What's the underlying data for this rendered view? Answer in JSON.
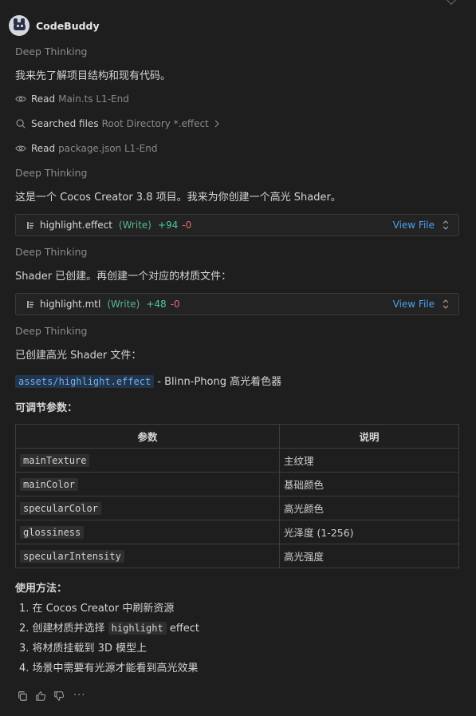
{
  "header": {
    "brand": "CodeBuddy"
  },
  "blocks": {
    "deep1": "Deep Thinking",
    "msg1": "我来先了解项目结构和现有代码。",
    "tool1": {
      "verb": "Read",
      "detail": "Main.ts L1-End"
    },
    "tool2": {
      "verb": "Searched files",
      "detail": "Root Directory *.effect"
    },
    "tool3": {
      "verb": "Read",
      "detail": "package.json L1-End"
    },
    "deep2": "Deep Thinking",
    "msg2": "这是一个 Cocos Creator 3.8 项目。我来为你创建一个高光 Shader。",
    "card1": {
      "file": "highlight.effect",
      "mode": "(Write)",
      "added": "+94",
      "removed": "-0",
      "view": "View File"
    },
    "deep3": "Deep Thinking",
    "msg3": "Shader 已创建。再创建一个对应的材质文件：",
    "card2": {
      "file": "highlight.mtl",
      "mode": "(Write)",
      "added": "+48",
      "removed": "-0",
      "view": "View File"
    },
    "deep4": "Deep Thinking",
    "msg4": "已创建高光 Shader 文件：",
    "file_path": "assets/highlight.effect",
    "file_desc": " - Blinn-Phong 高光着色器",
    "params_title": "可调节参数：",
    "usage_title": "使用方法："
  },
  "table": {
    "headers": [
      "参数",
      "说明"
    ],
    "rows": [
      [
        "mainTexture",
        "主纹理"
      ],
      [
        "mainColor",
        "基础颜色"
      ],
      [
        "specularColor",
        "高光颜色"
      ],
      [
        "glossiness",
        "光泽度 (1-256)"
      ],
      [
        "specularIntensity",
        "高光强度"
      ]
    ]
  },
  "usage": {
    "step1": "1. 在 Cocos Creator 中刷新资源",
    "step2_pre": "2. 创建材质并选择 ",
    "step2_code": "highlight",
    "step2_post": " effect",
    "step3": "3. 将材质挂载到 3D 模型上",
    "step4": "4. 场景中需要有光源才能看到高光效果"
  },
  "actions": {
    "more": "···"
  },
  "icons": [
    "eye-icon",
    "search-icon",
    "chevron-right-icon",
    "file-icon",
    "chevron-updown-icon",
    "copy-icon",
    "thumbs-up-icon",
    "thumbs-down-icon"
  ]
}
